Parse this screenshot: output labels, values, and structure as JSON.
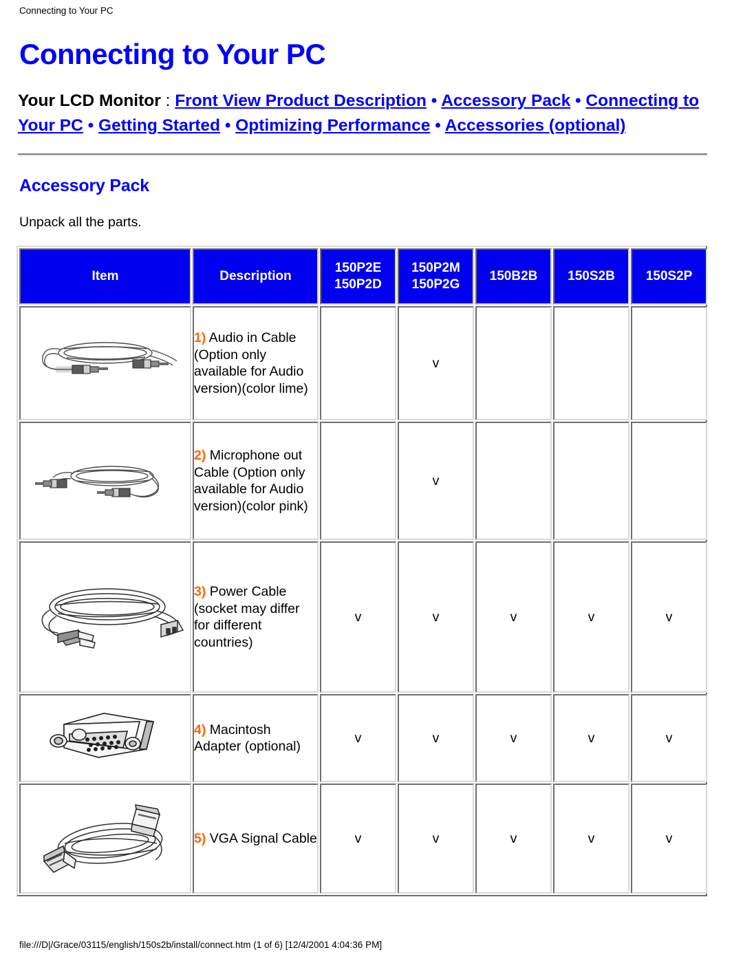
{
  "running_header": "Connecting to Your PC",
  "page_title": "Connecting to Your PC",
  "nav": {
    "lead": "Your LCD Monitor",
    "colon": " : ",
    "separator": " • ",
    "links": [
      "Front View Product Description",
      "Accessory Pack",
      "Connecting to Your PC",
      "Getting Started",
      "Optimizing Performance",
      "Accessories (optional)"
    ]
  },
  "section": {
    "title": "Accessory Pack",
    "lead": "Unpack all the parts."
  },
  "table": {
    "headers": {
      "item": "Item",
      "description": "Description",
      "model1_line1": "150P2E",
      "model1_line2": "150P2D",
      "model2_line1": "150P2M",
      "model2_line2": "150P2G",
      "model3": "150B2B",
      "model4": "150S2B",
      "model5": "150S2P"
    },
    "check_mark": "v",
    "rows": [
      {
        "icon": "audio-in-cable-image",
        "num": "1)",
        "desc": " Audio in Cable (Option only available for Audio version)(color lime)",
        "checks": [
          "",
          "v",
          "",
          "",
          ""
        ]
      },
      {
        "icon": "microphone-out-cable-image",
        "num": "2)",
        "desc": " Microphone out Cable (Option only available for Audio version)(color pink)",
        "checks": [
          "",
          "v",
          "",
          "",
          ""
        ]
      },
      {
        "icon": "power-cable-image",
        "num": "3)",
        "desc": " Power Cable (socket may differ for different countries)",
        "checks": [
          "v",
          "v",
          "v",
          "v",
          "v"
        ]
      },
      {
        "icon": "macintosh-adapter-image",
        "num": "4)",
        "desc": " Macintosh Adapter (optional)",
        "checks": [
          "v",
          "v",
          "v",
          "v",
          "v"
        ]
      },
      {
        "icon": "vga-signal-cable-image",
        "num": "5)",
        "desc": " VGA Signal Cable",
        "checks": [
          "v",
          "v",
          "v",
          "v",
          "v"
        ]
      }
    ]
  },
  "footer": "file:///D|/Grace/03115/english/150s2b/install/connect.htm (1 of 6) [12/4/2001 4:04:36 PM]",
  "colors": {
    "link_blue": "#0000ff",
    "header_blue": "#0000ee",
    "number_orange": "#ff6600",
    "text_black": "#000000"
  }
}
